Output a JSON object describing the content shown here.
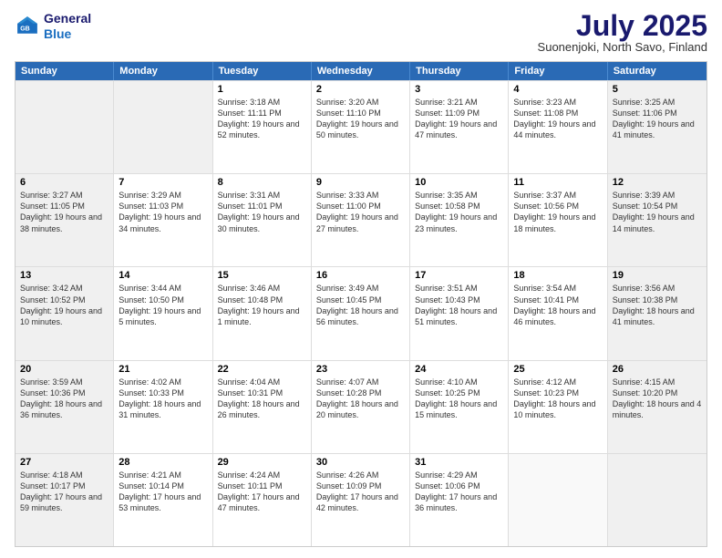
{
  "header": {
    "logo_line1": "General",
    "logo_line2": "Blue",
    "month_title": "July 2025",
    "location": "Suonenjoki, North Savo, Finland"
  },
  "days_of_week": [
    "Sunday",
    "Monday",
    "Tuesday",
    "Wednesday",
    "Thursday",
    "Friday",
    "Saturday"
  ],
  "weeks": [
    [
      {
        "day": "",
        "info": "",
        "shaded": true
      },
      {
        "day": "",
        "info": "",
        "shaded": true
      },
      {
        "day": "1",
        "info": "Sunrise: 3:18 AM\nSunset: 11:11 PM\nDaylight: 19 hours and 52 minutes.",
        "shaded": false
      },
      {
        "day": "2",
        "info": "Sunrise: 3:20 AM\nSunset: 11:10 PM\nDaylight: 19 hours and 50 minutes.",
        "shaded": false
      },
      {
        "day": "3",
        "info": "Sunrise: 3:21 AM\nSunset: 11:09 PM\nDaylight: 19 hours and 47 minutes.",
        "shaded": false
      },
      {
        "day": "4",
        "info": "Sunrise: 3:23 AM\nSunset: 11:08 PM\nDaylight: 19 hours and 44 minutes.",
        "shaded": false
      },
      {
        "day": "5",
        "info": "Sunrise: 3:25 AM\nSunset: 11:06 PM\nDaylight: 19 hours and 41 minutes.",
        "shaded": true
      }
    ],
    [
      {
        "day": "6",
        "info": "Sunrise: 3:27 AM\nSunset: 11:05 PM\nDaylight: 19 hours and 38 minutes.",
        "shaded": true
      },
      {
        "day": "7",
        "info": "Sunrise: 3:29 AM\nSunset: 11:03 PM\nDaylight: 19 hours and 34 minutes.",
        "shaded": false
      },
      {
        "day": "8",
        "info": "Sunrise: 3:31 AM\nSunset: 11:01 PM\nDaylight: 19 hours and 30 minutes.",
        "shaded": false
      },
      {
        "day": "9",
        "info": "Sunrise: 3:33 AM\nSunset: 11:00 PM\nDaylight: 19 hours and 27 minutes.",
        "shaded": false
      },
      {
        "day": "10",
        "info": "Sunrise: 3:35 AM\nSunset: 10:58 PM\nDaylight: 19 hours and 23 minutes.",
        "shaded": false
      },
      {
        "day": "11",
        "info": "Sunrise: 3:37 AM\nSunset: 10:56 PM\nDaylight: 19 hours and 18 minutes.",
        "shaded": false
      },
      {
        "day": "12",
        "info": "Sunrise: 3:39 AM\nSunset: 10:54 PM\nDaylight: 19 hours and 14 minutes.",
        "shaded": true
      }
    ],
    [
      {
        "day": "13",
        "info": "Sunrise: 3:42 AM\nSunset: 10:52 PM\nDaylight: 19 hours and 10 minutes.",
        "shaded": true
      },
      {
        "day": "14",
        "info": "Sunrise: 3:44 AM\nSunset: 10:50 PM\nDaylight: 19 hours and 5 minutes.",
        "shaded": false
      },
      {
        "day": "15",
        "info": "Sunrise: 3:46 AM\nSunset: 10:48 PM\nDaylight: 19 hours and 1 minute.",
        "shaded": false
      },
      {
        "day": "16",
        "info": "Sunrise: 3:49 AM\nSunset: 10:45 PM\nDaylight: 18 hours and 56 minutes.",
        "shaded": false
      },
      {
        "day": "17",
        "info": "Sunrise: 3:51 AM\nSunset: 10:43 PM\nDaylight: 18 hours and 51 minutes.",
        "shaded": false
      },
      {
        "day": "18",
        "info": "Sunrise: 3:54 AM\nSunset: 10:41 PM\nDaylight: 18 hours and 46 minutes.",
        "shaded": false
      },
      {
        "day": "19",
        "info": "Sunrise: 3:56 AM\nSunset: 10:38 PM\nDaylight: 18 hours and 41 minutes.",
        "shaded": true
      }
    ],
    [
      {
        "day": "20",
        "info": "Sunrise: 3:59 AM\nSunset: 10:36 PM\nDaylight: 18 hours and 36 minutes.",
        "shaded": true
      },
      {
        "day": "21",
        "info": "Sunrise: 4:02 AM\nSunset: 10:33 PM\nDaylight: 18 hours and 31 minutes.",
        "shaded": false
      },
      {
        "day": "22",
        "info": "Sunrise: 4:04 AM\nSunset: 10:31 PM\nDaylight: 18 hours and 26 minutes.",
        "shaded": false
      },
      {
        "day": "23",
        "info": "Sunrise: 4:07 AM\nSunset: 10:28 PM\nDaylight: 18 hours and 20 minutes.",
        "shaded": false
      },
      {
        "day": "24",
        "info": "Sunrise: 4:10 AM\nSunset: 10:25 PM\nDaylight: 18 hours and 15 minutes.",
        "shaded": false
      },
      {
        "day": "25",
        "info": "Sunrise: 4:12 AM\nSunset: 10:23 PM\nDaylight: 18 hours and 10 minutes.",
        "shaded": false
      },
      {
        "day": "26",
        "info": "Sunrise: 4:15 AM\nSunset: 10:20 PM\nDaylight: 18 hours and 4 minutes.",
        "shaded": true
      }
    ],
    [
      {
        "day": "27",
        "info": "Sunrise: 4:18 AM\nSunset: 10:17 PM\nDaylight: 17 hours and 59 minutes.",
        "shaded": true
      },
      {
        "day": "28",
        "info": "Sunrise: 4:21 AM\nSunset: 10:14 PM\nDaylight: 17 hours and 53 minutes.",
        "shaded": false
      },
      {
        "day": "29",
        "info": "Sunrise: 4:24 AM\nSunset: 10:11 PM\nDaylight: 17 hours and 47 minutes.",
        "shaded": false
      },
      {
        "day": "30",
        "info": "Sunrise: 4:26 AM\nSunset: 10:09 PM\nDaylight: 17 hours and 42 minutes.",
        "shaded": false
      },
      {
        "day": "31",
        "info": "Sunrise: 4:29 AM\nSunset: 10:06 PM\nDaylight: 17 hours and 36 minutes.",
        "shaded": false
      },
      {
        "day": "",
        "info": "",
        "shaded": false
      },
      {
        "day": "",
        "info": "",
        "shaded": true
      }
    ]
  ]
}
